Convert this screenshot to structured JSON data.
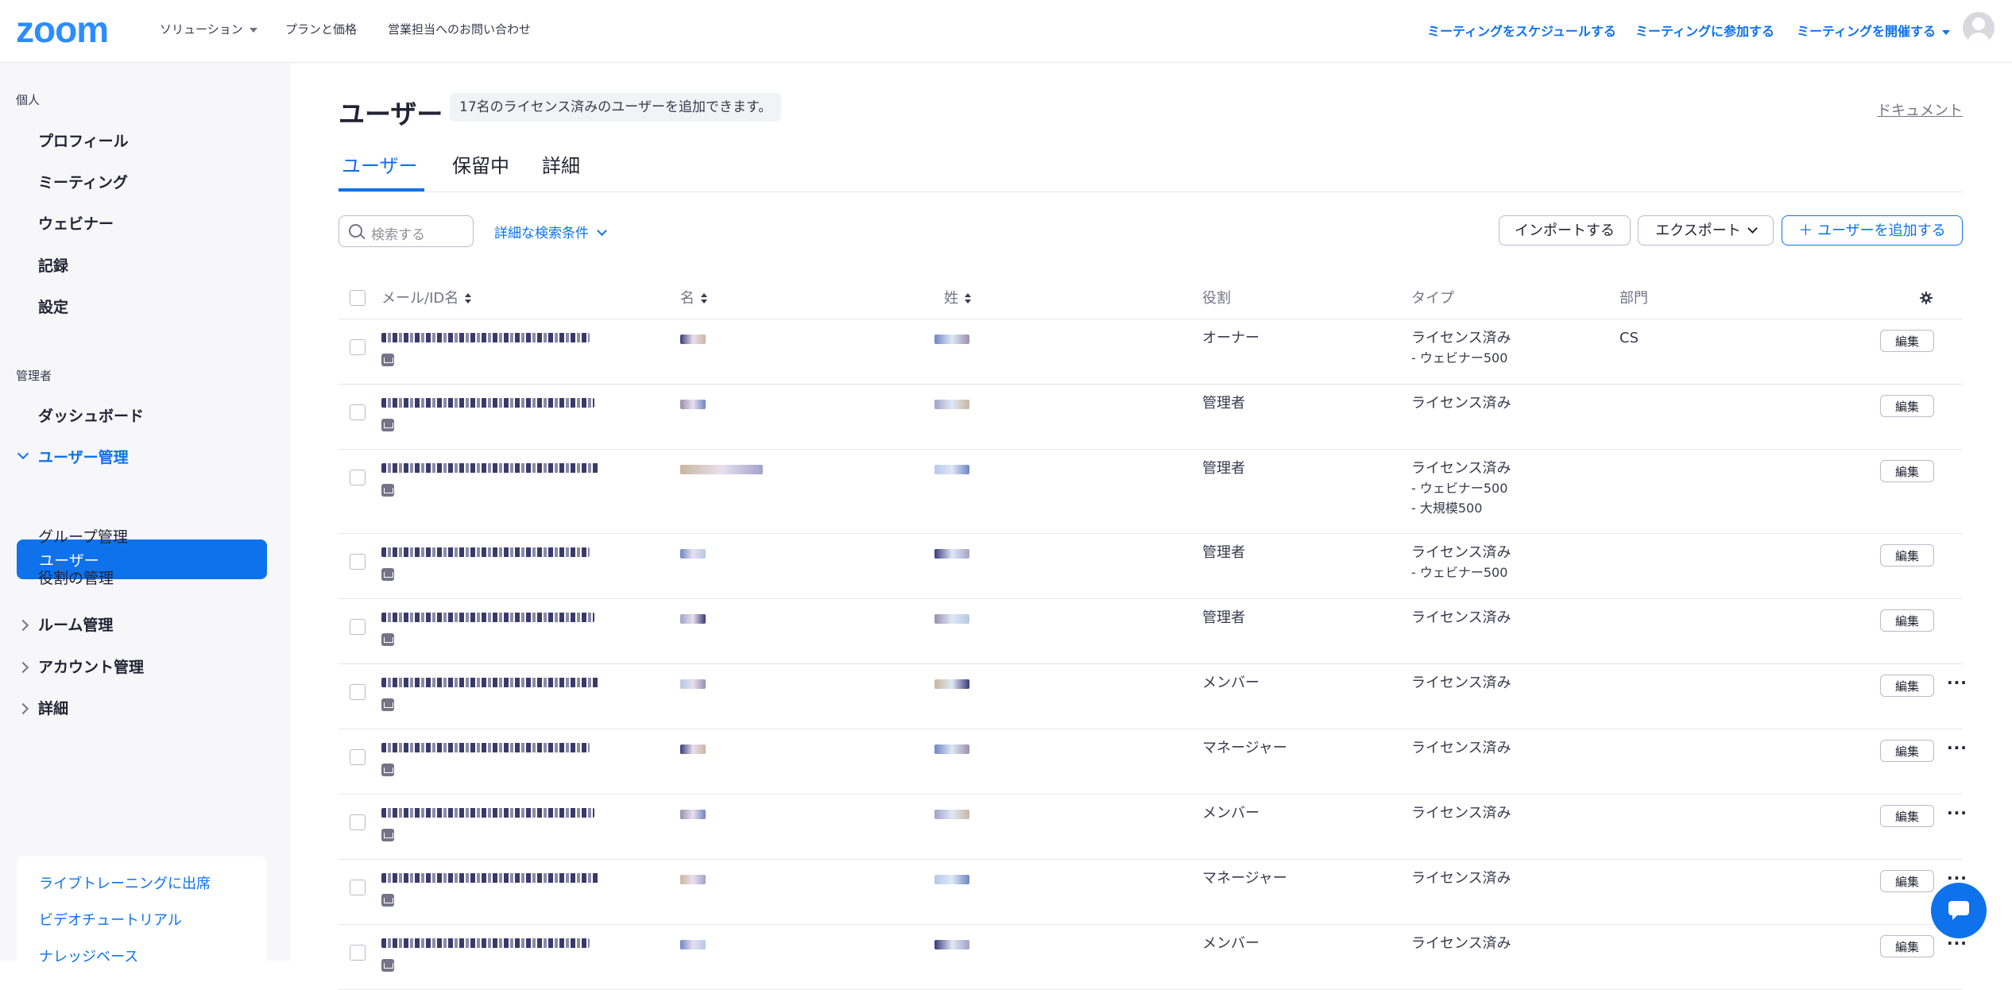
{
  "topbar": {
    "logo": "zoom",
    "nav": [
      "ソリューション",
      "プランと価格",
      "営業担当へのお問い合わせ"
    ],
    "right_nav": [
      "ミーティングをスケジュールする",
      "ミーティングに参加する",
      "ミーティングを開催する"
    ]
  },
  "sidebar": {
    "personal_title": "個人",
    "personal_items": [
      "プロフィール",
      "ミーティング",
      "ウェビナー",
      "記録",
      "設定"
    ],
    "admin_title": "管理者",
    "dashboard": "ダッシュボード",
    "user_mgmt": "ユーザー管理",
    "user_mgmt_children": [
      "ユーザー",
      "グループ管理",
      "役割の管理"
    ],
    "room_mgmt": "ルーム管理",
    "account_mgmt": "アカウント管理",
    "details": "詳細",
    "help_links": [
      "ライブトレーニングに出席",
      "ビデオチュートリアル",
      "ナレッジベース"
    ]
  },
  "page": {
    "title": "ユーザー",
    "license_note": "17名のライセンス済みのユーザーを追加できます。",
    "doc_link": "ドキュメント",
    "tabs": [
      "ユーザー",
      "保留中",
      "詳細"
    ]
  },
  "toolbar": {
    "search_placeholder": "検索する",
    "advanced_search": "詳細な検索条件",
    "import": "インポートする",
    "export": "エクスポート",
    "add_user": "＋ ユーザーを追加する"
  },
  "table": {
    "headers": [
      "メール/ID名",
      "名",
      "姓",
      "役割",
      "タイプ",
      "部門"
    ],
    "edit_label": "編集",
    "rows": [
      {
        "role": "オーナー",
        "type": [
          "ライセンス済み",
          "- ウェビナー500"
        ],
        "dept": "CS",
        "more": false
      },
      {
        "role": "管理者",
        "type": [
          "ライセンス済み"
        ],
        "dept": "",
        "more": false
      },
      {
        "role": "管理者",
        "type": [
          "ライセンス済み",
          "- ウェビナー500",
          "- 大規模500"
        ],
        "dept": "",
        "more": false
      },
      {
        "role": "管理者",
        "type": [
          "ライセンス済み",
          "- ウェビナー500"
        ],
        "dept": "",
        "more": false
      },
      {
        "role": "管理者",
        "type": [
          "ライセンス済み"
        ],
        "dept": "",
        "more": false
      },
      {
        "role": "メンバー",
        "type": [
          "ライセンス済み"
        ],
        "dept": "",
        "more": true
      },
      {
        "role": "マネージャー",
        "type": [
          "ライセンス済み"
        ],
        "dept": "",
        "more": true
      },
      {
        "role": "メンバー",
        "type": [
          "ライセンス済み"
        ],
        "dept": "",
        "more": true
      },
      {
        "role": "マネージャー",
        "type": [
          "ライセンス済み"
        ],
        "dept": "",
        "more": true
      },
      {
        "role": "メンバー",
        "type": [
          "ライセンス済み"
        ],
        "dept": "",
        "more": true
      }
    ]
  },
  "colors": {
    "accent": "#0e72ed",
    "brand": "#2d8cff"
  },
  "icons": [
    "search-icon",
    "gear-icon",
    "mail-icon",
    "chat-icon",
    "avatar-icon"
  ]
}
